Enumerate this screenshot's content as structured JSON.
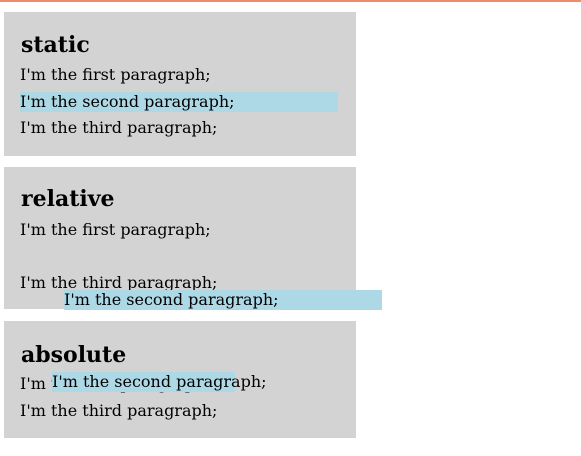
{
  "colors": {
    "box_background": "#d3d3d3",
    "highlight_background": "#add8e6",
    "top_border": "#f08a6c"
  },
  "sections": [
    {
      "title": "static",
      "paragraphs": [
        "I'm the first paragraph;",
        "I'm the second paragraph;",
        "I'm the third paragraph;"
      ]
    },
    {
      "title": "relative",
      "paragraphs": [
        "I'm the first paragraph;",
        "I'm the second paragraph;",
        "I'm the third paragraph;"
      ]
    },
    {
      "title": "absolute",
      "paragraphs": [
        "I'm the first paragraph;",
        "I'm the second paragraph;",
        "I'm the third paragraph;"
      ]
    }
  ]
}
